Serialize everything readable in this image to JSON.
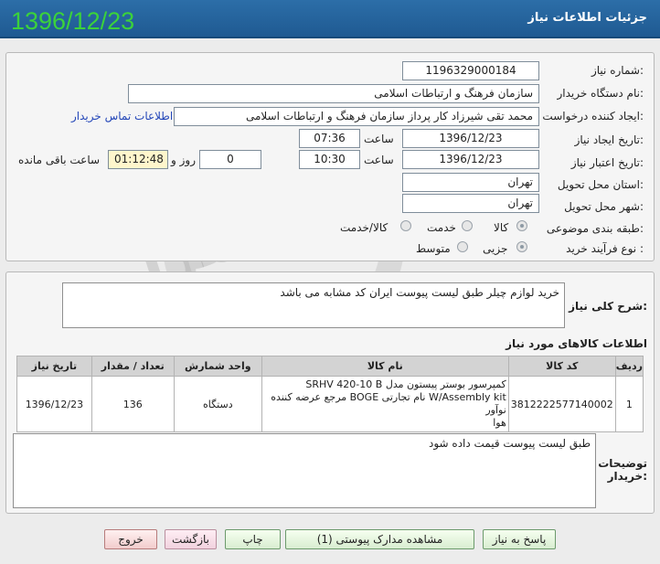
{
  "header": {
    "title": "جزئیات اطلاعات نیاز",
    "date_stamp": "1396/12/23"
  },
  "form": {
    "need_number_label": "شماره نیاز:",
    "need_number": "1196329000184",
    "buyer_org_label": "نام دستگاه خریدار:",
    "buyer_org": "سازمان فرهنگ و ارتباطات اسلامی",
    "creator_label": "ایجاد کننده درخواست:",
    "creator": "محمد تقی شیرزاد کار پرداز  سازمان فرهنگ و ارتباطات اسلامی",
    "contact_link": "اطلاعات تماس خریدار",
    "created_date_label": "تاریخ ایجاد نیاز:",
    "created_date": "1396/12/23",
    "time_label": "ساعت",
    "created_time": "07:36",
    "validity_label": "تاریخ اعتبار نیاز:",
    "validity_date": "1396/12/23",
    "validity_time": "10:30",
    "days_value": "0",
    "days_label": "روز و",
    "remaining_time": "01:12:48",
    "remaining_label": "ساعت باقی مانده",
    "province_label": "استان محل تحویل:",
    "province": "تهران",
    "city_label": "شهر محل تحویل:",
    "city": "تهران",
    "category_label": "طبقه بندی موضوعی:",
    "category_options": [
      "کالا",
      "خدمت",
      "کالا/خدمت"
    ],
    "process_label": "نوع فرآیند خرید :",
    "process_options": [
      "جزیی",
      "متوسط"
    ]
  },
  "summary": {
    "label": "شرح کلی نیاز:",
    "text": "خرید لوازم چیلر طبق لیست پیوست    ایران کد مشابه می باشد"
  },
  "items": {
    "title": "اطلاعات کالاهای مورد نیاز",
    "columns": [
      "ردیف",
      "کد کالا",
      "نام کالا",
      "واحد شمارش",
      "تعداد / مقدار",
      "تاریخ نیاز"
    ],
    "rows": [
      {
        "row": "1",
        "code": "3812222577140002",
        "name_line1": "کمپرسور بوستر پیستون مدل SRHV 420-10 B",
        "name_line2": "W/Assembly kit نام تجارتی BOGE مرجع عرضه کننده نوآور",
        "name_line3": "هوا",
        "unit": "دستگاه",
        "qty": "136",
        "date": "1396/12/23"
      }
    ]
  },
  "buyer_notes": {
    "label_line1": "توضیحات",
    "label_line2": "خریدار:",
    "text": "طبق لیست پیوست قیمت داده شود"
  },
  "buttons": {
    "reply": "پاسخ به نیاز",
    "attachments": "مشاهده مدارک پیوستی (1)",
    "print": "چاپ",
    "back": "بازگشت",
    "exit": "خروج"
  }
}
